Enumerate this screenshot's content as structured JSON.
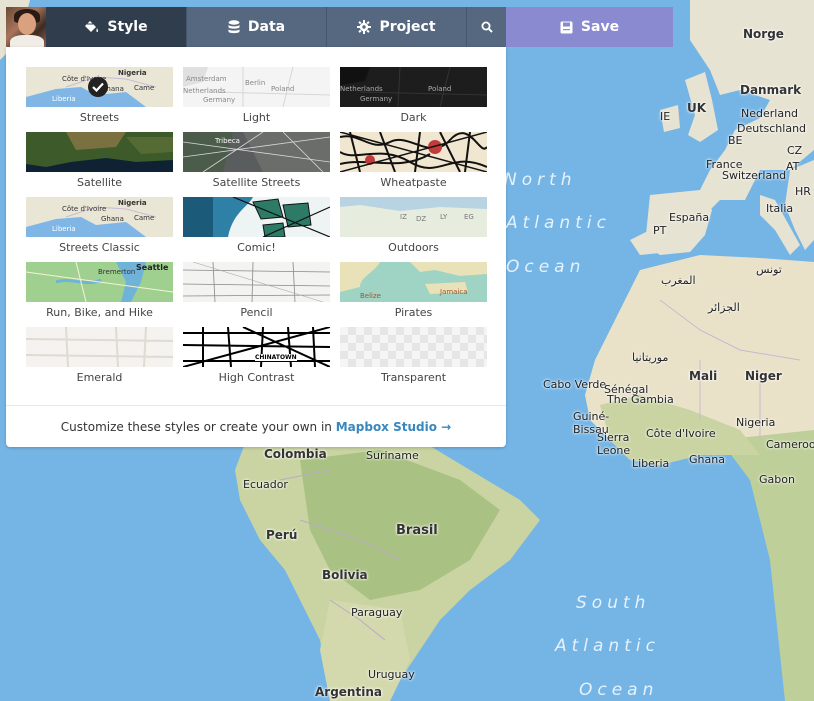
{
  "toolbar": {
    "tabs": [
      {
        "label": "Style",
        "icon": "paint-bucket-icon"
      },
      {
        "label": "Data",
        "icon": "database-icon"
      },
      {
        "label": "Project",
        "icon": "gear-icon"
      },
      {
        "label": "",
        "icon": "search-icon"
      }
    ],
    "save_label": "Save",
    "colors": {
      "active_tab": "#2f3d4d",
      "tab": "#55687f",
      "save": "#8a8ad0"
    }
  },
  "style_panel": {
    "selected": "Streets",
    "styles": [
      {
        "label": "Streets",
        "thumb_text": [
          "Nigeria",
          "Côte d'Ivoire",
          "Ghana",
          "Liberia",
          "Came"
        ]
      },
      {
        "label": "Light",
        "thumb_text": [
          "Amsterdam",
          "Berlin",
          "Netherlands",
          "Poland",
          "Germany"
        ]
      },
      {
        "label": "Dark",
        "thumb_text": [
          "Netherlands",
          "Poland",
          "Germany"
        ]
      },
      {
        "label": "Satellite",
        "thumb_text": []
      },
      {
        "label": "Satellite Streets",
        "thumb_text": [
          "Tribeca"
        ]
      },
      {
        "label": "Wheatpaste",
        "thumb_text": []
      },
      {
        "label": "Streets Classic",
        "thumb_text": [
          "Nigeria",
          "Côte d'Ivoire",
          "Ghana",
          "Liberia",
          "Came"
        ]
      },
      {
        "label": "Comic!",
        "thumb_text": []
      },
      {
        "label": "Outdoors",
        "thumb_text": [
          "IZ",
          "DZ",
          "LY",
          "EG"
        ]
      },
      {
        "label": "Run, Bike, and Hike",
        "thumb_text": [
          "Seattle",
          "Bremerton"
        ]
      },
      {
        "label": "Pencil",
        "thumb_text": []
      },
      {
        "label": "Pirates",
        "thumb_text": [
          "Belize",
          "Jamaica"
        ]
      },
      {
        "label": "Emerald",
        "thumb_text": []
      },
      {
        "label": "High Contrast",
        "thumb_text": [
          "CHINATOWN"
        ]
      },
      {
        "label": "Transparent",
        "thumb_text": []
      }
    ],
    "footer_text": "Customize these styles or create your own in",
    "footer_link": "Mapbox Studio",
    "footer_arrow": "→"
  },
  "map": {
    "labels": [
      "Norge",
      "Danmark",
      "UK",
      "IE",
      "Nederland",
      "Deutschland",
      "BE",
      "CZ",
      "France",
      "Switzerland",
      "AT",
      "Italia",
      "España",
      "PT",
      "HR",
      "تونس",
      "المغرب",
      "الجزائر",
      "موريتانيا",
      "Mali",
      "Niger",
      "Cabo Verde",
      "Sénégal",
      "The Gambia",
      "Guiné-Bissau",
      "Sierra Leone",
      "Côte d'Ivoire",
      "Nigeria",
      "Liberia",
      "Ghana",
      "Cameroon",
      "Gabon",
      "Colombia",
      "Suriname",
      "Ecuador",
      "Brasil",
      "Perú",
      "Bolivia",
      "Paraguay",
      "Uruguay",
      "Argentina"
    ],
    "oceans": [
      "North",
      "Atlantic",
      "Ocean",
      "South",
      "Atlantic",
      "Ocean"
    ]
  }
}
